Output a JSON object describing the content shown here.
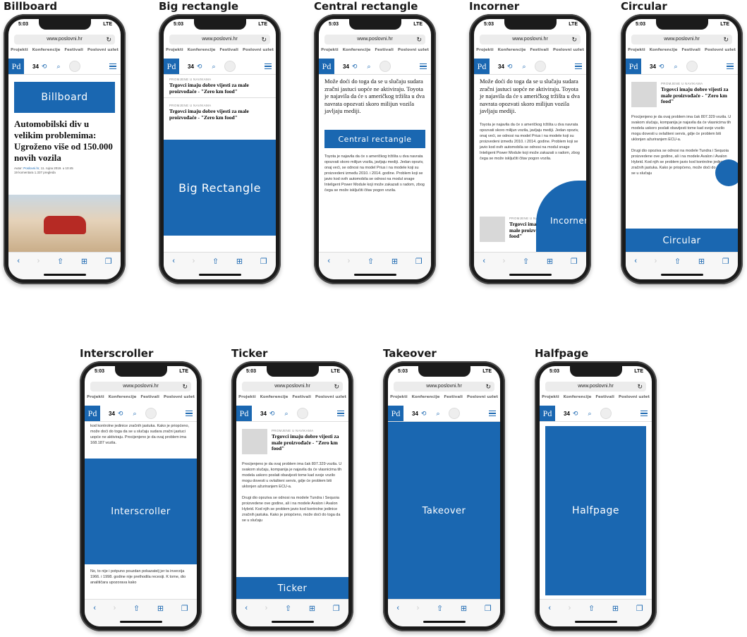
{
  "common": {
    "time": "5:03",
    "signal": "LTE",
    "url": "www.poslovni.hr",
    "nav_links": [
      "Projekti",
      "Konferencije",
      "Festivali",
      "Poslovni uzlet"
    ],
    "logo": "Pd",
    "comment_count": "34",
    "icons": [
      "back-icon",
      "forward-icon",
      "share-icon",
      "bookmarks-icon",
      "tabs-icon"
    ]
  },
  "colors": {
    "accent": "#1a67b1",
    "ad_text": "#ffffff"
  },
  "formats": [
    {
      "caption": "Billboard",
      "ad": "Billboard"
    },
    {
      "caption": "Big rectangle",
      "ad": "Big Rectangle"
    },
    {
      "caption": "Central rectangle",
      "ad": "Central rectangle"
    },
    {
      "caption": "Incorner",
      "ad": "Incorner"
    },
    {
      "caption": "Circular",
      "ad": "Circular"
    },
    {
      "caption": "Interscroller",
      "ad": "Interscroller"
    },
    {
      "caption": "Ticker",
      "ad": "Ticker"
    },
    {
      "caption": "Takeover",
      "ad": "Takeover"
    },
    {
      "caption": "Halfpage",
      "ad": "Halfpage"
    }
  ],
  "article": {
    "headline": "Automobilski div u velikim problemima: Ugroženo više od 150.000 novih vozila",
    "author_prefix": "Autor:",
    "author": "Poslovni.hr",
    "date": ", 11. rujna 2019. u 10:45",
    "stats": "19 komentara   1.337 pregleda",
    "kicker": "PROMJENE U NAVIKAMA",
    "teaser_title": "Trgovci imaju dobre vijesti za male proizvođače - \"Zero km food\"",
    "serif_para": "Može doći do toga da se u slučaju sudara zračni jastuci uopće ne aktiviraju. Toyota je najavila da će s američkog tržišta u dva navrata opozvati skoro milijun vozila javljaju mediji.",
    "para1": "Toyota je najavila da će s američkog tržišta u dva navrata opozvati skoro milijun vozila, javljaju mediji. Jedan opoziv, onaj veći, se odnosi na model Prius i na modele koji su proizvedeni između 2010. i 2014. godine. Problem koji se javio kod ovih automobila se odnosi na modul snage Inteligent Power Module koji može zakazati s radom, zbog čega se može isključiti čitav pogon vozila.",
    "para2": "Procijenjeno je da ovaj problem ima čak 807.329 vozila. U svakom slučaju, kompanija je najavila da će vlasnicima tih modela uskoro poslati obavijesti tome kad svoje vozilo mogu dovesti u ovlašteni servis, gdje će problem biti uklonjen ažuriranjem ECU-a.",
    "para3": "Drugi dio opoziva se odnosi na modele Tundra i Sequoia proizvedene ove godine, ali i na modele Avalon i Avalon Hybrid. Kod njih se problem javio kod kontrolne jedinice zračnih jastuka. Kako je priopćeno, može doći do toga da se u slučaju",
    "para4": "kod kontrolne jedinice zračnih jastuka. Kako je priopćeno, može doći do toga da se u slučaju sudara zračni jastuci uopće ne aktiviraju. Procijenjeno je da ovaj problem ima 168.187 vozila.",
    "para5": "No, to nije i potpuno pouzdan pokazatelj jer ta inverzija 1966. i 1998. godine nije prethodila recesiji. K tome, dio analitičara upozorava kako"
  }
}
